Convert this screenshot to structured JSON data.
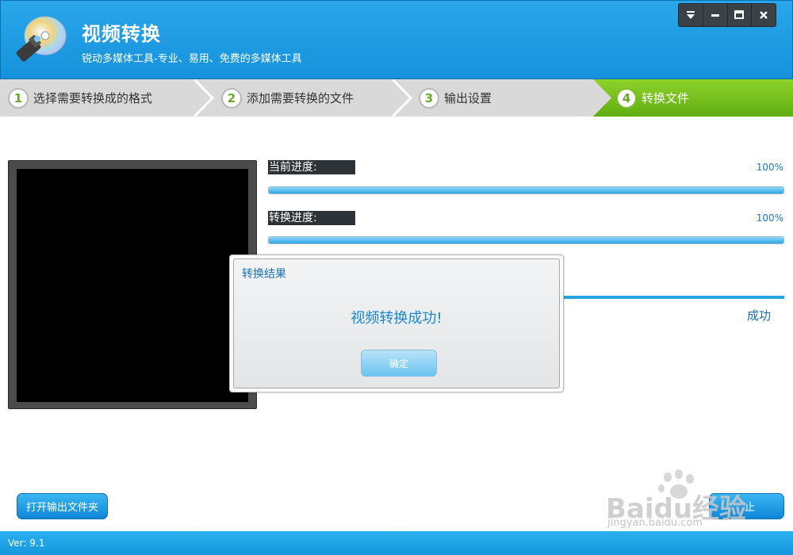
{
  "app": {
    "title": "视频转换",
    "subtitle": "锐动多媒体工具-专业、易用、免费的多媒体工具",
    "version": "Ver: 9.1"
  },
  "window_controls": [
    "menu-dropdown-icon",
    "minimize-icon",
    "maximize-icon",
    "close-icon"
  ],
  "steps": [
    {
      "num": "1",
      "label": "选择需要转换成的格式",
      "active": false
    },
    {
      "num": "2",
      "label": "添加需要转换的文件",
      "active": false
    },
    {
      "num": "3",
      "label": "输出设置",
      "active": false
    },
    {
      "num": "4",
      "label": "转换文件",
      "active": true
    }
  ],
  "progress": {
    "current": {
      "label": "当前进度:",
      "percent_text": "100%",
      "value": 100
    },
    "convert": {
      "label": "转换进度:",
      "percent_text": "100%",
      "value": 100
    }
  },
  "background_status": "成功",
  "dialog": {
    "title": "转换结果",
    "message": "视频转换成功!",
    "ok_label": "确定"
  },
  "buttons": {
    "open_folder": "打开输出文件夹",
    "right_partial": "止"
  },
  "watermark": {
    "text": "Baidu经验",
    "url": "jingyan.baidu.com"
  },
  "colors": {
    "header": "#1e9be4",
    "step_active": "#6cbc1a",
    "accent_text": "#1a86d2"
  }
}
